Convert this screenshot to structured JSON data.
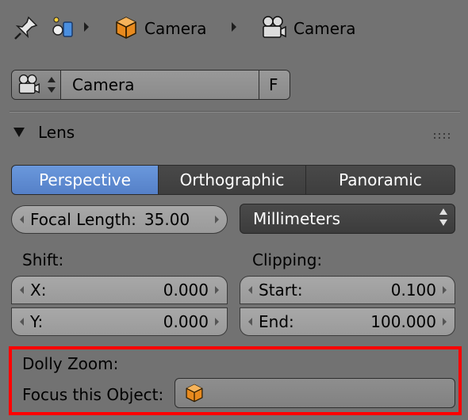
{
  "header": {
    "breadcrumb": [
      {
        "icon": "pin-icon"
      },
      {
        "icon": "scene-icon"
      },
      {
        "icon": "object-cube-icon",
        "label": "Camera"
      },
      {
        "icon": "camera-icon",
        "label": "Camera"
      }
    ]
  },
  "datablock": {
    "name": "Camera",
    "fake_user_label": "F"
  },
  "lens_panel": {
    "title": "Lens",
    "tabs": [
      "Perspective",
      "Orthographic",
      "Panoramic"
    ],
    "active_tab": "Perspective",
    "focal_length_label": "Focal Length:",
    "focal_length_value": "35.00",
    "unit_dropdown": "Millimeters",
    "shift_label": "Shift:",
    "shift_x_label": "X:",
    "shift_x_value": "0.000",
    "shift_y_label": "Y:",
    "shift_y_value": "0.000",
    "clipping_label": "Clipping:",
    "clip_start_label": "Start:",
    "clip_start_value": "0.100",
    "clip_end_label": "End:",
    "clip_end_value": "100.000"
  },
  "dolly_zoom": {
    "title": "Dolly Zoom:",
    "focus_label": "Focus this Object:",
    "focus_value": ""
  },
  "colors": {
    "panel_bg": "#727272",
    "active_tab": "#5a86cc",
    "highlight": "#ff0000"
  }
}
